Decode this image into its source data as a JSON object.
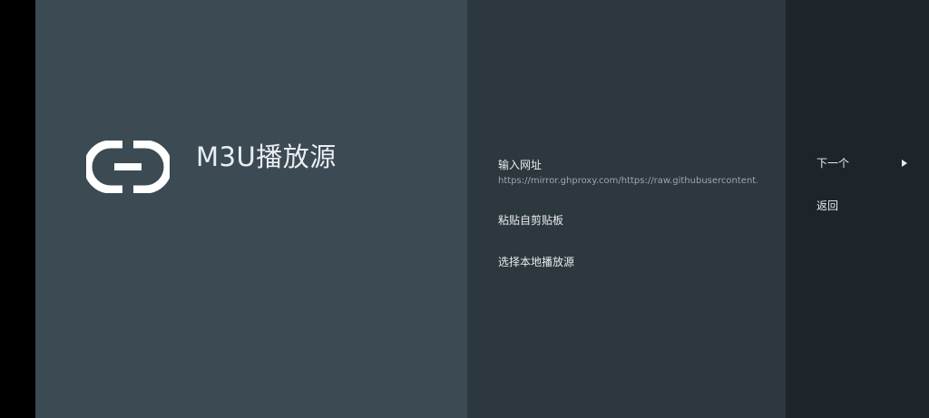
{
  "guidance": {
    "title": "M3U播放源",
    "icon": "link-icon"
  },
  "actions": [
    {
      "title": "输入网址",
      "description": "https://mirror.ghproxy.com/https://raw.githubusercontent.c"
    },
    {
      "title": "粘贴自剪贴板"
    },
    {
      "title": "选择本地播放源"
    }
  ],
  "buttons": {
    "next_label": "下一个",
    "back_label": "返回"
  },
  "colors": {
    "guidance_bg": "#3b4a53",
    "actions_bg": "#2d373e",
    "buttons_bg": "#1e252a",
    "text": "#e8edf0",
    "subtext": "#9aa6ad"
  }
}
